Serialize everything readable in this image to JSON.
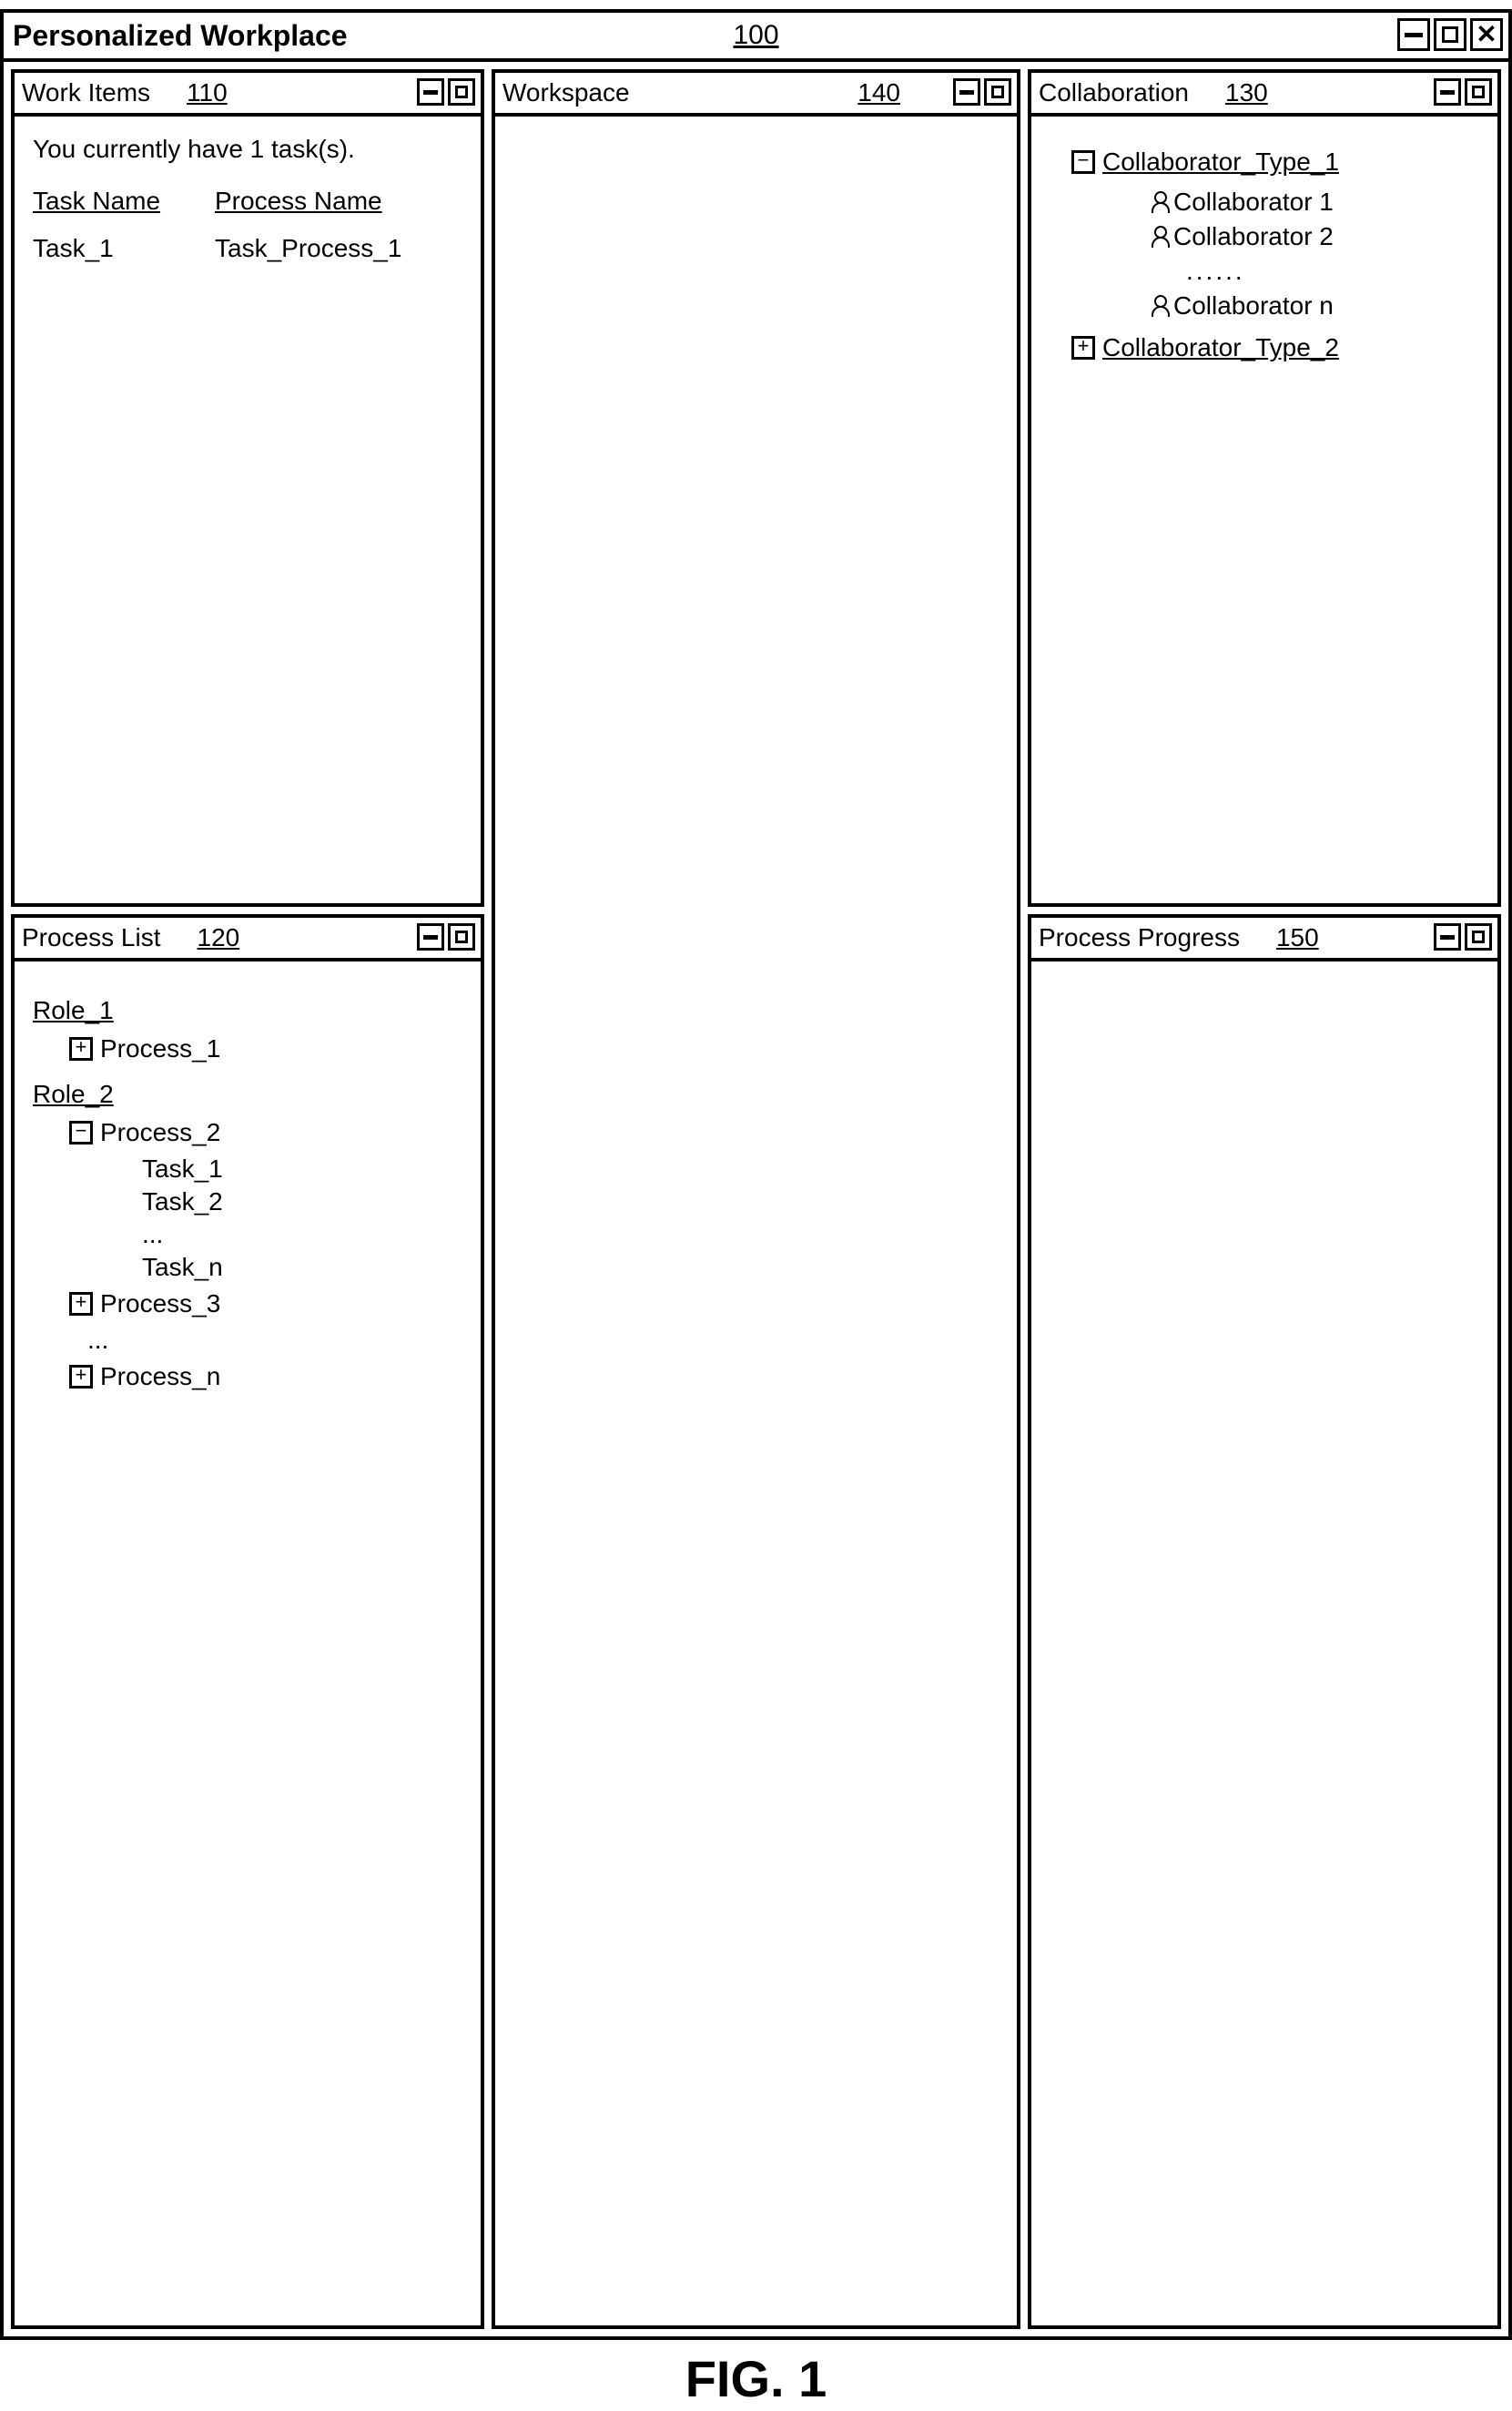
{
  "window": {
    "title": "Personalized Workplace",
    "ref": "100"
  },
  "panels": {
    "workItems": {
      "title": "Work Items",
      "ref": "110",
      "status": "You currently have 1 task(s).",
      "headers": {
        "task": "Task Name",
        "process": "Process Name"
      },
      "rows": [
        {
          "task": "Task_1",
          "process": "Task_Process_1"
        }
      ]
    },
    "processList": {
      "title": "Process List",
      "ref": "120",
      "roles": [
        {
          "name": "Role_1",
          "processes": [
            {
              "name": "Process_1",
              "expanded": false
            }
          ]
        },
        {
          "name": "Role_2",
          "processes": [
            {
              "name": "Process_2",
              "expanded": true,
              "tasks": [
                "Task_1",
                "Task_2",
                "...",
                "Task_n"
              ]
            },
            {
              "name": "Process_3",
              "expanded": false
            },
            {
              "name": "Process_n",
              "expanded": false,
              "prefixEllipsis": true
            }
          ]
        }
      ]
    },
    "workspace": {
      "title": "Workspace",
      "ref": "140"
    },
    "collaboration": {
      "title": "Collaboration",
      "ref": "130",
      "types": [
        {
          "name": "Collaborator_Type_1",
          "expanded": true,
          "members": [
            "Collaborator 1",
            "Collaborator 2"
          ],
          "ellipsis": true,
          "tail": "Collaborator n"
        },
        {
          "name": "Collaborator_Type_2",
          "expanded": false
        }
      ]
    },
    "progress": {
      "title": "Process Progress",
      "ref": "150"
    }
  },
  "figure": "FIG. 1"
}
